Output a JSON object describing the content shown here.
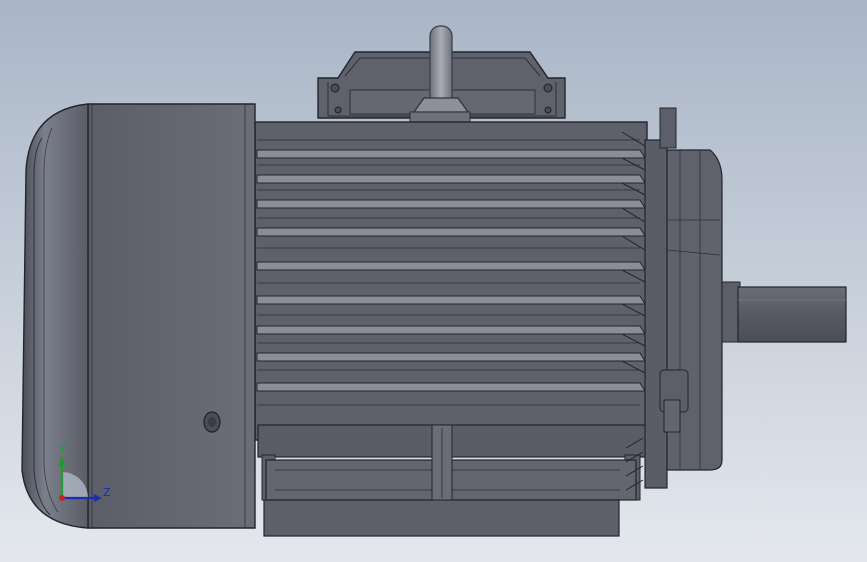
{
  "viewport": {
    "background_top": "#a9b5c6",
    "background_bottom": "#e4e8ee"
  },
  "model": {
    "body_color": "#5d606b",
    "edge_color": "#23252b",
    "highlight_color": "#8c909c",
    "shadow_color": "#3e4049"
  },
  "triad": {
    "y_label": "Y",
    "z_label": "Z",
    "y_color": "#1f9d2a",
    "z_color": "#1a2fb0",
    "x_color": "#c0282a"
  }
}
